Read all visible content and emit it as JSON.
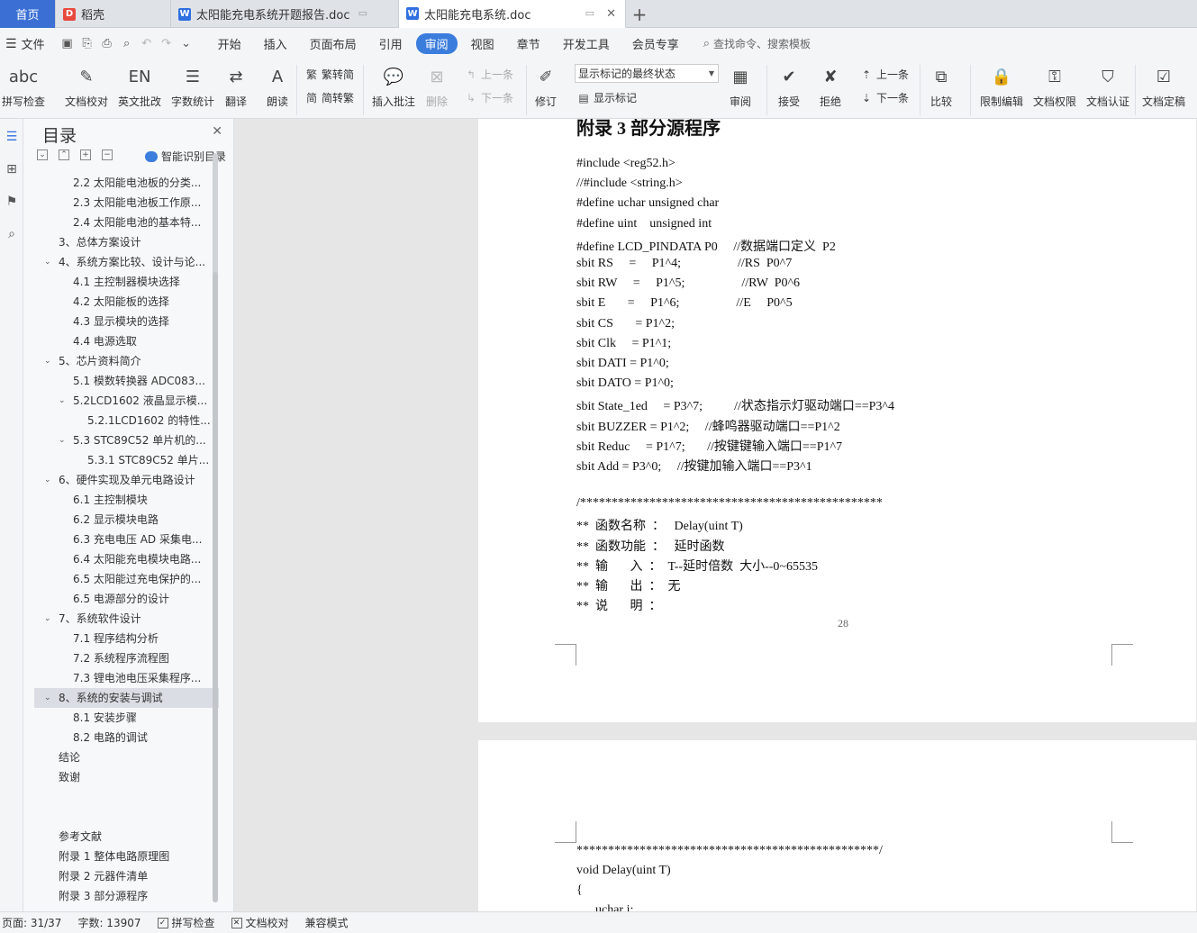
{
  "tabs": {
    "home": "首页",
    "daoke": "稻壳",
    "doc1": "太阳能充电系统开题报告.doc",
    "doc2": "太阳能充电系统.doc"
  },
  "menubar": {
    "file": "文件",
    "items": [
      "开始",
      "插入",
      "页面布局",
      "引用",
      "审阅",
      "视图",
      "章节",
      "开发工具",
      "会员专享"
    ],
    "active": "审阅",
    "search": "查找命令、搜索模板"
  },
  "ribbon": {
    "spellcheck": "拼写检查",
    "doc_proof": "文档校对",
    "en_review": "英文批改",
    "word_count": "字数统计",
    "translate": "翻译",
    "read_aloud": "朗读",
    "trad_to_simp": "繁转简",
    "simp_to_trad": "简转繁",
    "insert_comment": "插入批注",
    "delete": "删除",
    "prev_comment": "上一条",
    "next_comment": "下一条",
    "track_changes": "修订",
    "markup_state": "显示标记的最终状态",
    "show_markup": "显示标记",
    "review": "审阅",
    "accept": "接受",
    "reject": "拒绝",
    "prev_change": "上一条",
    "next_change": "下一条",
    "compare": "比较",
    "restrict_edit": "限制编辑",
    "doc_rights": "文档权限",
    "doc_cert": "文档认证",
    "doc_finalize": "文档定稿"
  },
  "toc": {
    "title": "目录",
    "smart": "智能识别目录",
    "items": [
      {
        "label": "2.2 太阳能电池板的分类...",
        "level": 2,
        "caret": ""
      },
      {
        "label": "2.3 太阳能电池板工作原...",
        "level": 2,
        "caret": ""
      },
      {
        "label": "2.4 太阳能电池的基本特...",
        "level": 2,
        "caret": ""
      },
      {
        "label": "3、总体方案设计",
        "level": 1,
        "caret": ""
      },
      {
        "label": "4、系统方案比较、设计与论...",
        "level": 1,
        "caret": "⌄"
      },
      {
        "label": "4.1 主控制器模块选择",
        "level": 2,
        "caret": ""
      },
      {
        "label": "4.2 太阳能板的选择",
        "level": 2,
        "caret": ""
      },
      {
        "label": "4.3 显示模块的选择",
        "level": 2,
        "caret": ""
      },
      {
        "label": "4.4 电源选取",
        "level": 2,
        "caret": ""
      },
      {
        "label": "5、芯片资料简介",
        "level": 1,
        "caret": "⌄"
      },
      {
        "label": "5.1 模数转换器 ADC083...",
        "level": 2,
        "caret": ""
      },
      {
        "label": "5.2LCD1602 液晶显示模...",
        "level": 2,
        "caret": "⌄"
      },
      {
        "label": "5.2.1LCD1602 的特性...",
        "level": 3,
        "caret": ""
      },
      {
        "label": "5.3 STC89C52 单片机的...",
        "level": 2,
        "caret": "⌄"
      },
      {
        "label": "5.3.1 STC89C52 单片...",
        "level": 3,
        "caret": ""
      },
      {
        "label": "6、硬件实现及单元电路设计",
        "level": 1,
        "caret": "⌄"
      },
      {
        "label": "6.1 主控制模块",
        "level": 2,
        "caret": ""
      },
      {
        "label": "6.2 显示模块电路",
        "level": 2,
        "caret": ""
      },
      {
        "label": "6.3 充电电压 AD 采集电...",
        "level": 2,
        "caret": ""
      },
      {
        "label": "6.4 太阳能充电模块电路...",
        "level": 2,
        "caret": ""
      },
      {
        "label": "6.5 太阳能过充电保护的...",
        "level": 2,
        "caret": ""
      },
      {
        "label": "6.5 电源部分的设计",
        "level": 2,
        "caret": ""
      },
      {
        "label": "7、系统软件设计",
        "level": 1,
        "caret": "⌄"
      },
      {
        "label": "7.1 程序结构分析",
        "level": 2,
        "caret": ""
      },
      {
        "label": "7.2 系统程序流程图",
        "level": 2,
        "caret": ""
      },
      {
        "label": "7.3 锂电池电压采集程序...",
        "level": 2,
        "caret": ""
      },
      {
        "label": "8、系统的安装与调试",
        "level": 1,
        "caret": "⌄",
        "selected": true
      },
      {
        "label": "8.1 安装步骤",
        "level": 2,
        "caret": ""
      },
      {
        "label": "8.2 电路的调试",
        "level": 2,
        "caret": ""
      },
      {
        "label": "结论",
        "level": 1,
        "caret": ""
      },
      {
        "label": "致谢",
        "level": 1,
        "caret": ""
      },
      {
        "label": "",
        "level": 1,
        "caret": ""
      },
      {
        "label": "",
        "level": 1,
        "caret": ""
      },
      {
        "label": "参考文献",
        "level": 1,
        "caret": ""
      },
      {
        "label": "附录 1 整体电路原理图",
        "level": 1,
        "caret": ""
      },
      {
        "label": "附录 2 元器件清单",
        "level": 1,
        "caret": ""
      },
      {
        "label": "附录 3 部分源程序",
        "level": 1,
        "caret": ""
      }
    ]
  },
  "document": {
    "heading": "附录 3 部分源程序",
    "lines": [
      "#include <reg52.h>",
      "//#include <string.h>",
      "#define uchar unsigned char",
      "#define uint    unsigned int",
      "#define LCD_PINDATA P0     //数据端口定义  P2",
      "sbit RS     =     P1^4;                  //RS  P0^7",
      "sbit RW     =     P1^5;                  //RW  P0^6",
      "sbit E       =     P1^6;                  //E     P0^5",
      "sbit CS       = P1^2;",
      "sbit Clk     = P1^1;",
      "sbit DATI = P1^0;",
      "sbit DATO = P1^0;",
      "sbit State_1ed     = P3^7;          //状态指示灯驱动端口==P3^4",
      "sbit BUZZER = P1^2;     //蜂鸣器驱动端口==P1^2",
      "sbit Reduc     = P1^7;       //按键键输入端口==P1^7",
      "sbit Add = P3^0;     //按键加输入端口==P3^1",
      "",
      "/************************************************",
      "**  函数名称  ：   Delay(uint T)",
      "**  函数功能  ：   延时函数",
      "**  输       入  ：  T--延时倍数  大小--0~65535",
      "**  输       出  ：  无",
      "**  说       明  ："
    ],
    "page_number": "28",
    "page2_lines": [
      "************************************************/",
      "void Delay(uint T)",
      "{",
      "      uchar i;"
    ]
  },
  "status": {
    "page": "页面: 31/37",
    "words": "字数: 13907",
    "spell": "拼写检查",
    "proof": "文档校对",
    "compat": "兼容模式"
  }
}
